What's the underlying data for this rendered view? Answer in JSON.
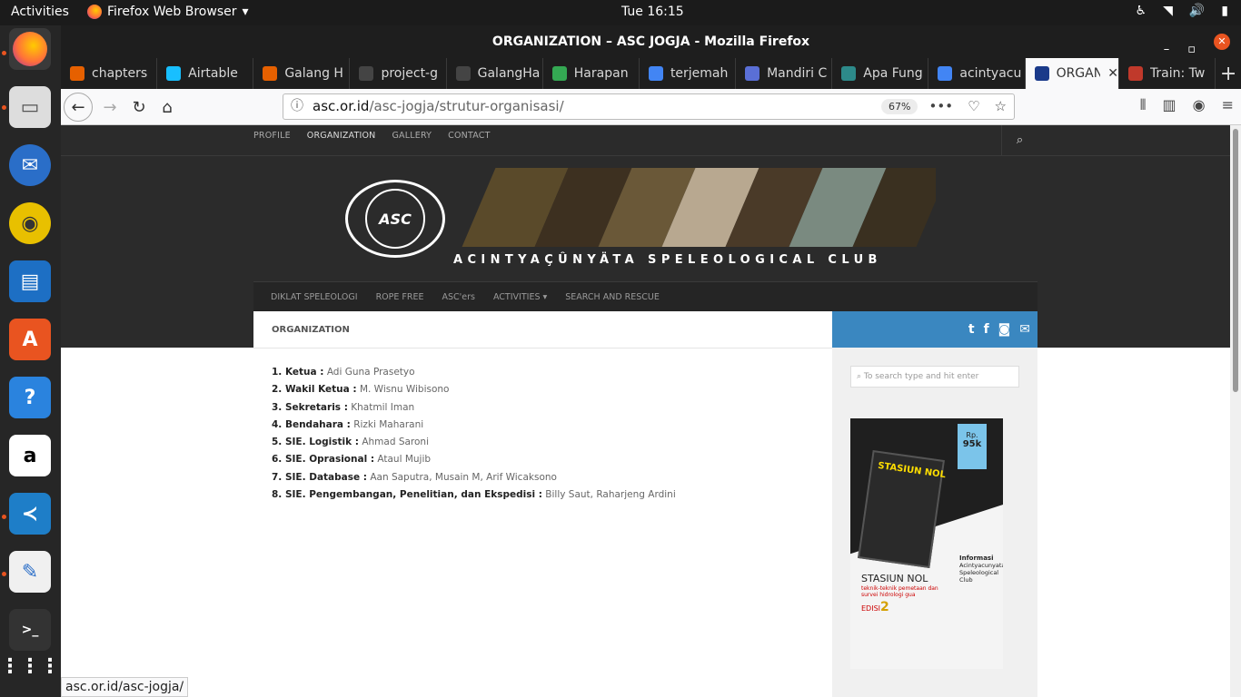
{
  "topbar": {
    "activities": "Activities",
    "app_name": "Firefox Web Browser",
    "clock": "Tue 16:15"
  },
  "window": {
    "title": "ORGANIZATION – ASC JOGJA - Mozilla Firefox"
  },
  "tabs": [
    {
      "label": "chapters",
      "color": "#e66000"
    },
    {
      "label": "Airtable",
      "color": "#18bfff"
    },
    {
      "label": "Galang H",
      "color": "#e66000"
    },
    {
      "label": "project-g",
      "color": "#444444"
    },
    {
      "label": "GalangHa",
      "color": "#444444"
    },
    {
      "label": "Harapan",
      "color": "#34a853"
    },
    {
      "label": "terjemah",
      "color": "#4285f4"
    },
    {
      "label": "Mandiri C",
      "color": "#5a6fd6"
    },
    {
      "label": "Apa Fung",
      "color": "#2d8a8a"
    },
    {
      "label": "acintyacu",
      "color": "#4285f4"
    },
    {
      "label": "ORGAN",
      "color": "#1a3a8a"
    },
    {
      "label": "Train: Tw",
      "color": "#c0392b"
    }
  ],
  "nav": {
    "url_host": "asc.or.id",
    "url_path": "/asc-jogja/strutur-organisasi/",
    "zoom": "67%"
  },
  "site": {
    "topnav": [
      "PROFILE",
      "ORGANIZATION",
      "GALLERY",
      "CONTACT"
    ],
    "logo_text": "ASC",
    "name": "ACINTYAÇÛNYÄTA SPELEOLOGICAL CLUB",
    "mainnav": [
      "DIKLAT SPELEOLOGI",
      "ROPE FREE",
      "ASC'ers",
      "ACTIVITIES ▾",
      "SEARCH AND RESCUE"
    ],
    "breadcrumb": "ORGANIZATION",
    "members": [
      {
        "role": "1. Ketua :",
        "name": "Adi Guna Prasetyo"
      },
      {
        "role": "2. Wakil Ketua :",
        "name": "M. Wisnu Wibisono"
      },
      {
        "role": "3. Sekretaris :",
        "name": "Khatmil Iman"
      },
      {
        "role": "4. Bendahara :",
        "name": "Rizki Maharani"
      },
      {
        "role": "5. SIE. Logistik :",
        "name": "Ahmad Saroni"
      },
      {
        "role": "6. SIE. Oprasional :",
        "name": "Ataul Mujib"
      },
      {
        "role": "7. SIE. Database :",
        "name": "Aan Saputra, Musain M, Arif Wicaksono"
      },
      {
        "role": "8. SIE. Pengembangan, Penelitian, dan Ekspedisi :",
        "name": "Billy Saut, Raharjeng Ardini"
      }
    ],
    "search_placeholder": "To search type and hit enter",
    "poster": {
      "price_label": "Rp.",
      "price": "95k",
      "book_title": "STASIUN NOL",
      "title": "STASIUN NOL",
      "subtitle": "teknik-teknik pemetaan dan survei hidrologi gua",
      "edition_label": "EDISI",
      "edition": "2",
      "info_title": "Informasi",
      "info_text": "Acintyacunyata Speleological Club"
    }
  },
  "status_url": "asc.or.id/asc-jogja/"
}
